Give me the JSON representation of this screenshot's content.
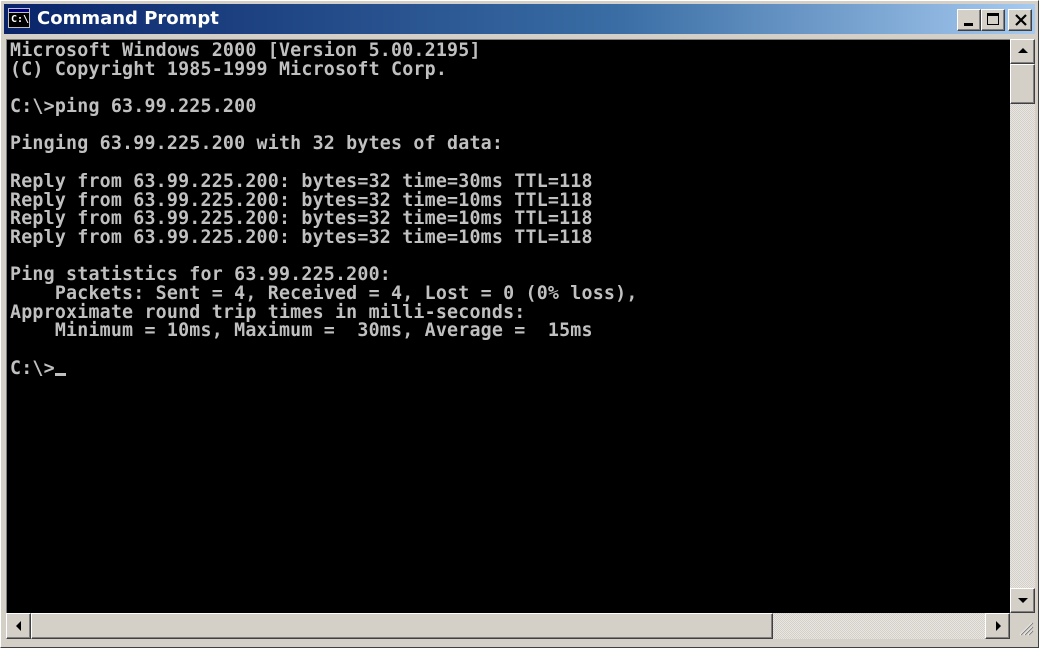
{
  "window": {
    "title": "Command Prompt",
    "icon": "console-icon",
    "icon_glyph": "C:\\",
    "controls": [
      "minimize-icon",
      "maximize-icon",
      "close-icon"
    ]
  },
  "console": {
    "colors": {
      "background": "#000000",
      "foreground": "#c0c0c0"
    },
    "lines": [
      "Microsoft Windows 2000 [Version 5.00.2195]",
      "(C) Copyright 1985-1999 Microsoft Corp.",
      "",
      "C:\\>ping 63.99.225.200",
      "",
      "Pinging 63.99.225.200 with 32 bytes of data:",
      "",
      "Reply from 63.99.225.200: bytes=32 time=30ms TTL=118",
      "Reply from 63.99.225.200: bytes=32 time=10ms TTL=118",
      "Reply from 63.99.225.200: bytes=32 time=10ms TTL=118",
      "Reply from 63.99.225.200: bytes=32 time=10ms TTL=118",
      "",
      "Ping statistics for 63.99.225.200:",
      "    Packets: Sent = 4, Received = 4, Lost = 0 (0% loss),",
      "Approximate round trip times in milli-seconds:",
      "    Minimum = 10ms, Maximum =  30ms, Average =  15ms",
      ""
    ],
    "prompt": "C:\\>"
  },
  "scrollbars": {
    "vertical": {
      "up_icon": "scroll-up-arrow-icon",
      "down_icon": "scroll-down-arrow-icon"
    },
    "horizontal": {
      "left_icon": "scroll-left-arrow-icon",
      "right_icon": "scroll-right-arrow-icon"
    }
  }
}
